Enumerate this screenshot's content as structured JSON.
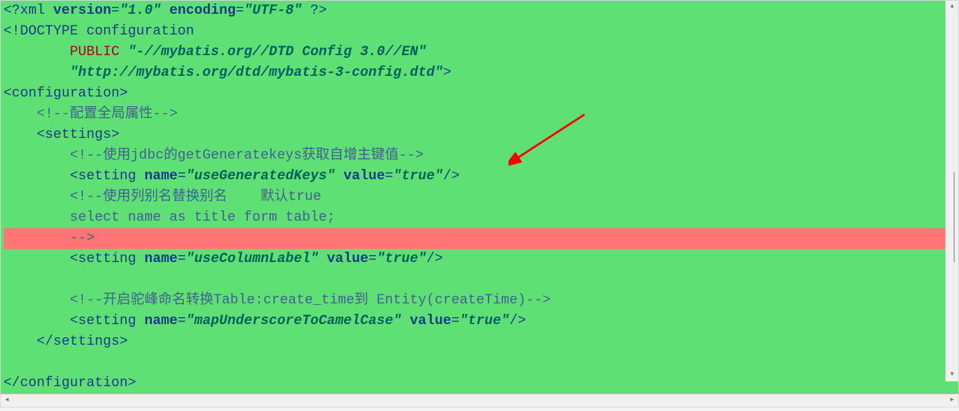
{
  "code": {
    "lines": [
      {
        "indent": 0,
        "segments": [
          {
            "cls": "punct",
            "text": "<?"
          },
          {
            "cls": "tag",
            "text": "xml "
          },
          {
            "cls": "attr",
            "text": "version"
          },
          {
            "cls": "punct",
            "text": "="
          },
          {
            "cls": "str",
            "text": "\"1.0\""
          },
          {
            "cls": "tag",
            "text": " "
          },
          {
            "cls": "attr",
            "text": "encoding"
          },
          {
            "cls": "punct",
            "text": "="
          },
          {
            "cls": "str",
            "text": "\"UTF-8\""
          },
          {
            "cls": "tag",
            "text": " "
          },
          {
            "cls": "punct",
            "text": "?>"
          }
        ]
      },
      {
        "indent": 0,
        "segments": [
          {
            "cls": "doctype",
            "text": "<!DOCTYPE configuration"
          }
        ]
      },
      {
        "indent": 8,
        "segments": [
          {
            "cls": "public",
            "text": "PUBLIC "
          },
          {
            "cls": "str",
            "text": "\"-//mybatis.org//DTD Config 3.0//EN\""
          }
        ]
      },
      {
        "indent": 8,
        "segments": [
          {
            "cls": "str",
            "text": "\"http://mybatis.org/dtd/mybatis-3-config.dtd\""
          },
          {
            "cls": "doctype",
            "text": ">"
          }
        ]
      },
      {
        "indent": 0,
        "segments": [
          {
            "cls": "punct",
            "text": "<"
          },
          {
            "cls": "tag",
            "text": "configuration"
          },
          {
            "cls": "punct",
            "text": ">"
          }
        ]
      },
      {
        "indent": 4,
        "segments": [
          {
            "cls": "comment",
            "text": "<!--配置全局属性-->"
          }
        ]
      },
      {
        "indent": 4,
        "segments": [
          {
            "cls": "punct",
            "text": "<"
          },
          {
            "cls": "tag",
            "text": "settings"
          },
          {
            "cls": "punct",
            "text": ">"
          }
        ]
      },
      {
        "indent": 8,
        "segments": [
          {
            "cls": "comment",
            "text": "<!--使用jdbc的getGeneratekeys获取自增主键值-->"
          }
        ]
      },
      {
        "indent": 8,
        "segments": [
          {
            "cls": "punct",
            "text": "<"
          },
          {
            "cls": "tag",
            "text": "setting "
          },
          {
            "cls": "attr",
            "text": "name"
          },
          {
            "cls": "punct",
            "text": "="
          },
          {
            "cls": "str",
            "text": "\"useGeneratedKeys\""
          },
          {
            "cls": "tag",
            "text": " "
          },
          {
            "cls": "attr",
            "text": "value"
          },
          {
            "cls": "punct",
            "text": "="
          },
          {
            "cls": "str",
            "text": "\"true\""
          },
          {
            "cls": "punct",
            "text": "/>"
          }
        ]
      },
      {
        "indent": 8,
        "segments": [
          {
            "cls": "comment",
            "text": "<!--使用列别名替换别名    默认true"
          }
        ]
      },
      {
        "indent": 8,
        "segments": [
          {
            "cls": "comment",
            "text": "select name as title form table;"
          }
        ]
      },
      {
        "indent": 8,
        "highlight": true,
        "segments": [
          {
            "cls": "comment",
            "text": "-->"
          }
        ]
      },
      {
        "indent": 8,
        "segments": [
          {
            "cls": "punct",
            "text": "<"
          },
          {
            "cls": "tag",
            "text": "setting "
          },
          {
            "cls": "attr",
            "text": "name"
          },
          {
            "cls": "punct",
            "text": "="
          },
          {
            "cls": "str",
            "text": "\"useColumnLabel\""
          },
          {
            "cls": "tag",
            "text": " "
          },
          {
            "cls": "attr",
            "text": "value"
          },
          {
            "cls": "punct",
            "text": "="
          },
          {
            "cls": "str",
            "text": "\"true\""
          },
          {
            "cls": "punct",
            "text": "/>"
          }
        ]
      },
      {
        "blank": true
      },
      {
        "indent": 8,
        "segments": [
          {
            "cls": "comment",
            "text": "<!--开启驼峰命名转换Table:create_time到 Entity(createTime)-->"
          }
        ]
      },
      {
        "indent": 8,
        "segments": [
          {
            "cls": "punct",
            "text": "<"
          },
          {
            "cls": "tag",
            "text": "setting "
          },
          {
            "cls": "attr",
            "text": "name"
          },
          {
            "cls": "punct",
            "text": "="
          },
          {
            "cls": "str",
            "text": "\"mapUnderscoreToCamelCase\""
          },
          {
            "cls": "tag",
            "text": " "
          },
          {
            "cls": "attr",
            "text": "value"
          },
          {
            "cls": "punct",
            "text": "="
          },
          {
            "cls": "str",
            "text": "\"true\""
          },
          {
            "cls": "punct",
            "text": "/>"
          }
        ]
      },
      {
        "indent": 4,
        "segments": [
          {
            "cls": "punct",
            "text": "</"
          },
          {
            "cls": "tag",
            "text": "settings"
          },
          {
            "cls": "punct",
            "text": ">"
          }
        ]
      },
      {
        "blank": true
      },
      {
        "indent": 0,
        "segments": [
          {
            "cls": "punct",
            "text": "</"
          },
          {
            "cls": "tag",
            "text": "configuration"
          },
          {
            "cls": "punct",
            "text": ">"
          }
        ]
      }
    ]
  },
  "scrollbar": {
    "up": "▴",
    "down": "▾",
    "left": "◂",
    "right": "▸"
  },
  "arrow_color": "#ff0000"
}
